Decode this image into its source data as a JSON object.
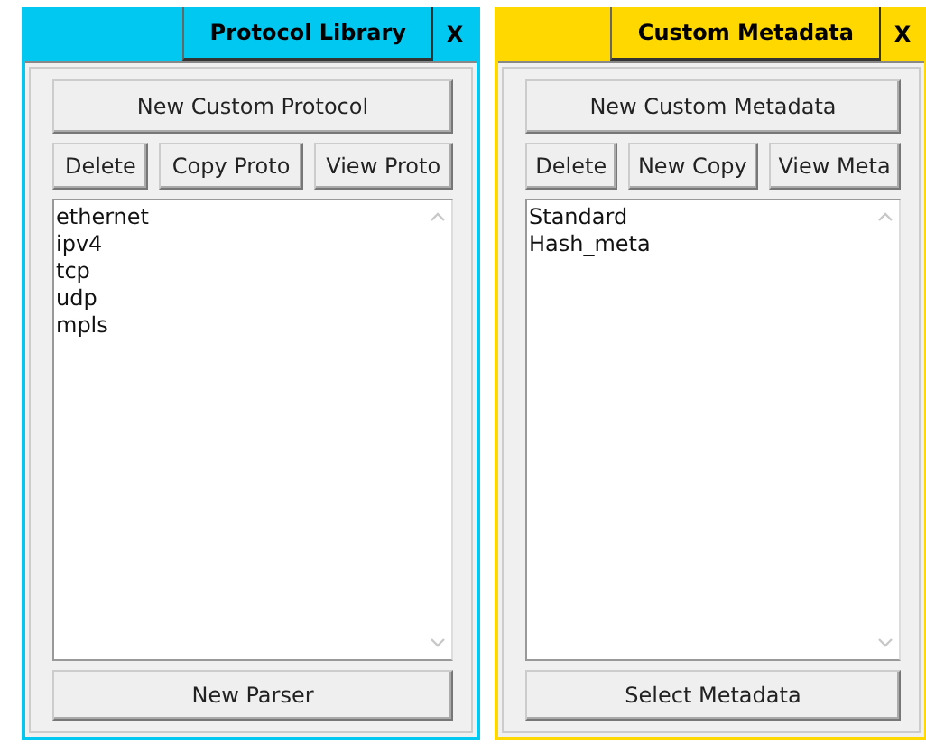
{
  "panels": [
    {
      "title": "Protocol Library",
      "close": "X",
      "color": "#00c8f0",
      "main_button": "New Custom Protocol",
      "buttons": [
        "Delete",
        "Copy Proto",
        "View Proto"
      ],
      "items": [
        "ethernet",
        "ipv4",
        "tcp",
        "udp",
        "mpls"
      ],
      "bottom_button": "New Parser"
    },
    {
      "title": "Custom Metadata",
      "close": "X",
      "color": "#ffd800",
      "main_button": "New Custom Metadata",
      "buttons": [
        "Delete",
        "New Copy",
        "View Meta"
      ],
      "items": [
        "Standard",
        "Hash_meta"
      ],
      "bottom_button": "Select Metadata"
    }
  ]
}
